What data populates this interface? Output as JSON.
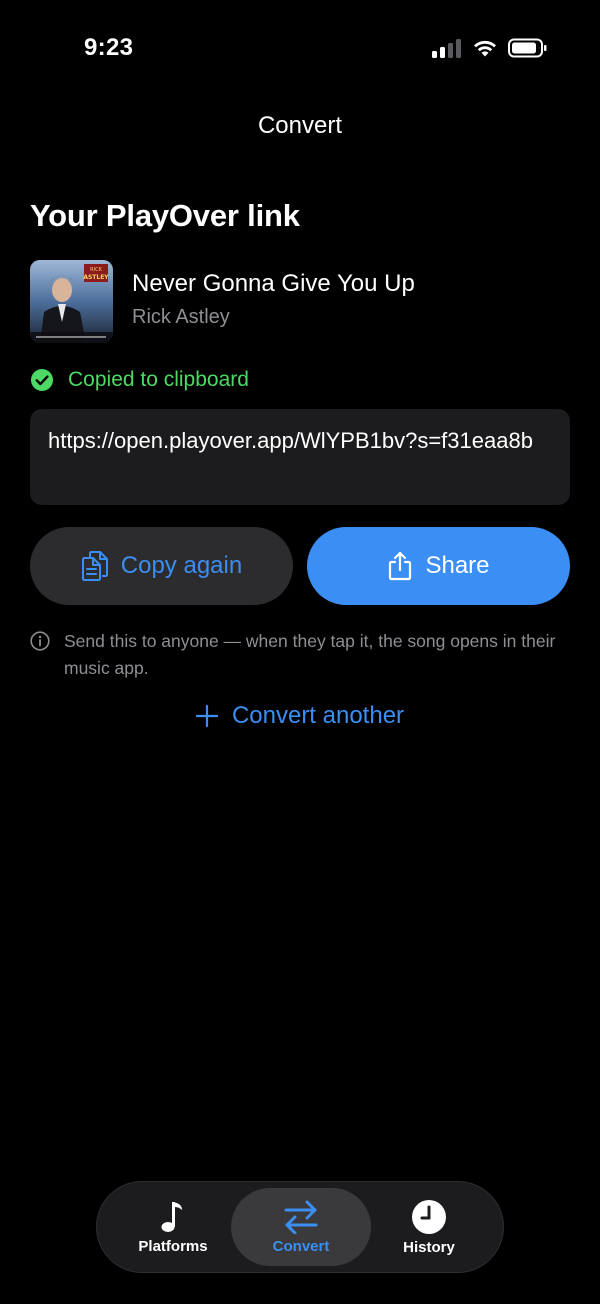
{
  "status_bar": {
    "time": "9:23"
  },
  "nav": {
    "title": "Convert"
  },
  "heading": "Your PlayOver link",
  "song": {
    "title": "Never Gonna Give You Up",
    "artist": "Rick Astley"
  },
  "copied_message": "Copied to clipboard",
  "link": "https://open.playover.app/WlYPB1bv?s=f31eaa8b",
  "buttons": {
    "copy_again": "Copy again",
    "share": "Share"
  },
  "info_text": "Send this to anyone — when they tap it, the song opens in their music app.",
  "convert_another": "Convert another",
  "tabs": [
    {
      "label": "Platforms",
      "icon": "music-note-icon",
      "selected": false
    },
    {
      "label": "Convert",
      "icon": "arrows-swap-icon",
      "selected": true
    },
    {
      "label": "History",
      "icon": "clock-icon",
      "selected": false
    }
  ],
  "colors": {
    "accent": "#3b8ef3",
    "success": "#4cd964",
    "secondary_text": "#8e8e93",
    "card": "#1c1c1e"
  }
}
